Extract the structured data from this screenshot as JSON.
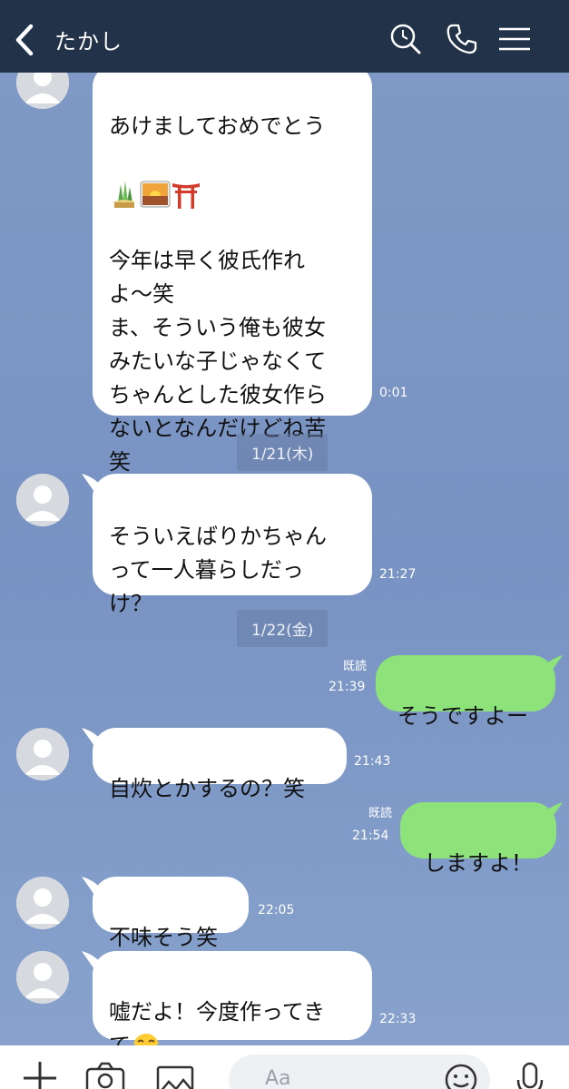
{
  "header": {
    "title": "たかし",
    "icons": [
      "back-icon",
      "search-icon",
      "phone-icon",
      "menu-icon"
    ]
  },
  "messages": [
    {
      "from": "other",
      "text": "あけましておめでとう",
      "time": "0:01",
      "emojis": [
        "kadomatsu",
        "sunrise",
        "torii"
      ],
      "text2": "今年は早く彼氏作れ\nよ〜笑\nま、そういう俺も彼女\nみたいな子じゃなくて\nちゃんとした彼女作ら\nないとなんだけどね苦\n笑"
    },
    {
      "from": "other",
      "text": "そういえばりかちゃん\nって一人暮らしだっ\nけ？",
      "time": "21:27"
    },
    {
      "from": "me",
      "text": "そうですよー",
      "time": "21:39",
      "read": "既読"
    },
    {
      "from": "other",
      "text": "自炊とかするの？笑",
      "time": "21:43"
    },
    {
      "from": "me",
      "text": "しますよ！",
      "time": "21:54",
      "read": "既読"
    },
    {
      "from": "other",
      "text": "不味そう笑",
      "time": "22:05"
    },
    {
      "from": "other",
      "text": "嘘だよ！今度作ってき\nて",
      "time": "22:33",
      "emojis": [
        "tears-of-joy"
      ]
    }
  ],
  "dates": [
    "1/21(木)",
    "1/22(金)"
  ],
  "footer": {
    "placeholder": "Aa",
    "icons": [
      "plus-icon",
      "camera-icon",
      "image-icon",
      "emoji-icon",
      "mic-icon"
    ]
  },
  "colors": {
    "header": "#223249",
    "background": "#7b96c4",
    "my_bubble": "#8de27a",
    "other_bubble": "#ffffff"
  }
}
